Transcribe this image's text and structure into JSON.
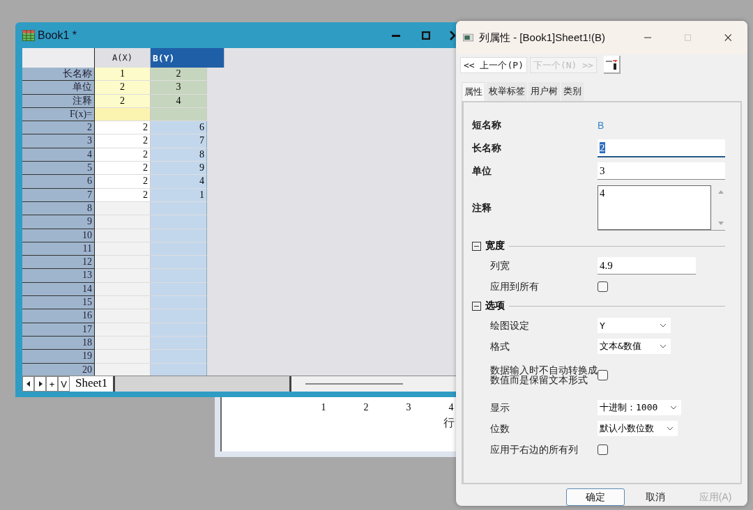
{
  "graph_window": {
    "x_ticks": [
      "1",
      "2",
      "3",
      "4"
    ],
    "axis_title": "行"
  },
  "worksheet": {
    "title": "Book1 *",
    "columns": [
      {
        "label": "A(X)",
        "selected": false
      },
      {
        "label": "B(Y)",
        "selected": true
      }
    ],
    "meta_rows": [
      {
        "label": "长名称",
        "values": [
          "1",
          "2"
        ]
      },
      {
        "label": "单位",
        "values": [
          "2",
          "3"
        ]
      },
      {
        "label": "注释",
        "values": [
          "2",
          "4"
        ]
      },
      {
        "label": "F(x)=",
        "values": []
      }
    ],
    "rows": [
      {
        "label": "2",
        "values": [
          "2",
          "6"
        ]
      },
      {
        "label": "3",
        "values": [
          "2",
          "7"
        ]
      },
      {
        "label": "4",
        "values": [
          "2",
          "8"
        ]
      },
      {
        "label": "5",
        "values": [
          "2",
          "9"
        ]
      },
      {
        "label": "6",
        "values": [
          "2",
          "4"
        ]
      },
      {
        "label": "7",
        "values": [
          "2",
          "1"
        ]
      },
      {
        "label": "8",
        "values": []
      },
      {
        "label": "9",
        "values": []
      },
      {
        "label": "10",
        "values": []
      },
      {
        "label": "11",
        "values": []
      },
      {
        "label": "12",
        "values": []
      },
      {
        "label": "13",
        "values": []
      },
      {
        "label": "14",
        "values": []
      },
      {
        "label": "15",
        "values": []
      },
      {
        "label": "16",
        "values": []
      },
      {
        "label": "17",
        "values": []
      },
      {
        "label": "18",
        "values": []
      },
      {
        "label": "19",
        "values": []
      },
      {
        "label": "20",
        "values": []
      }
    ],
    "sheet_nav": [
      "+",
      "V"
    ],
    "sheet_tab": "Sheet1"
  },
  "dialog": {
    "title": "列属性 - [Book1]Sheet1!(B)",
    "nav_buttons": [
      {
        "label": "<< 上一个(P)",
        "disabled": false
      },
      {
        "label": "下一个(N) >>",
        "disabled": true
      }
    ],
    "tabs": [
      {
        "label": "属性",
        "selected": true
      },
      {
        "label": "枚举标签",
        "selected": false
      },
      {
        "label": "用户树",
        "selected": false
      },
      {
        "label": "类别",
        "selected": false
      }
    ],
    "fields": [
      {
        "kind": "text",
        "label": "短名称",
        "value": "B"
      },
      {
        "kind": "input",
        "label": "长名称",
        "value": "2"
      },
      {
        "kind": "input",
        "label": "单位",
        "value": "3"
      },
      {
        "kind": "textarea",
        "label": "注释",
        "value": "4"
      }
    ],
    "sections": [
      {
        "title": "宽度",
        "expanded": true,
        "items": [
          {
            "kind": "input",
            "label": "列宽",
            "value": "4.9"
          },
          {
            "kind": "checkbox",
            "label": "应用到所有",
            "checked": false
          }
        ]
      },
      {
        "title": "选项",
        "expanded": true,
        "items": [
          {
            "kind": "select",
            "label": "绘图设定",
            "value": "Y"
          },
          {
            "kind": "select",
            "label": "格式",
            "value": "文本&数值"
          },
          {
            "kind": "checkbox",
            "label": "数据输入时不自动转换成数值而是保留文本形式",
            "checked": false
          },
          {
            "kind": "select",
            "label": "显示",
            "value": "十进制：1000"
          },
          {
            "kind": "select",
            "label": "位数",
            "value": "默认小数位数"
          },
          {
            "kind": "checkbox",
            "label": "应用于右边的所有列",
            "checked": false
          }
        ]
      }
    ],
    "buttons": [
      {
        "label": "确定",
        "disabled": false
      },
      {
        "label": "取消",
        "disabled": false
      },
      {
        "label": "应用(A)",
        "disabled": true
      }
    ]
  }
}
